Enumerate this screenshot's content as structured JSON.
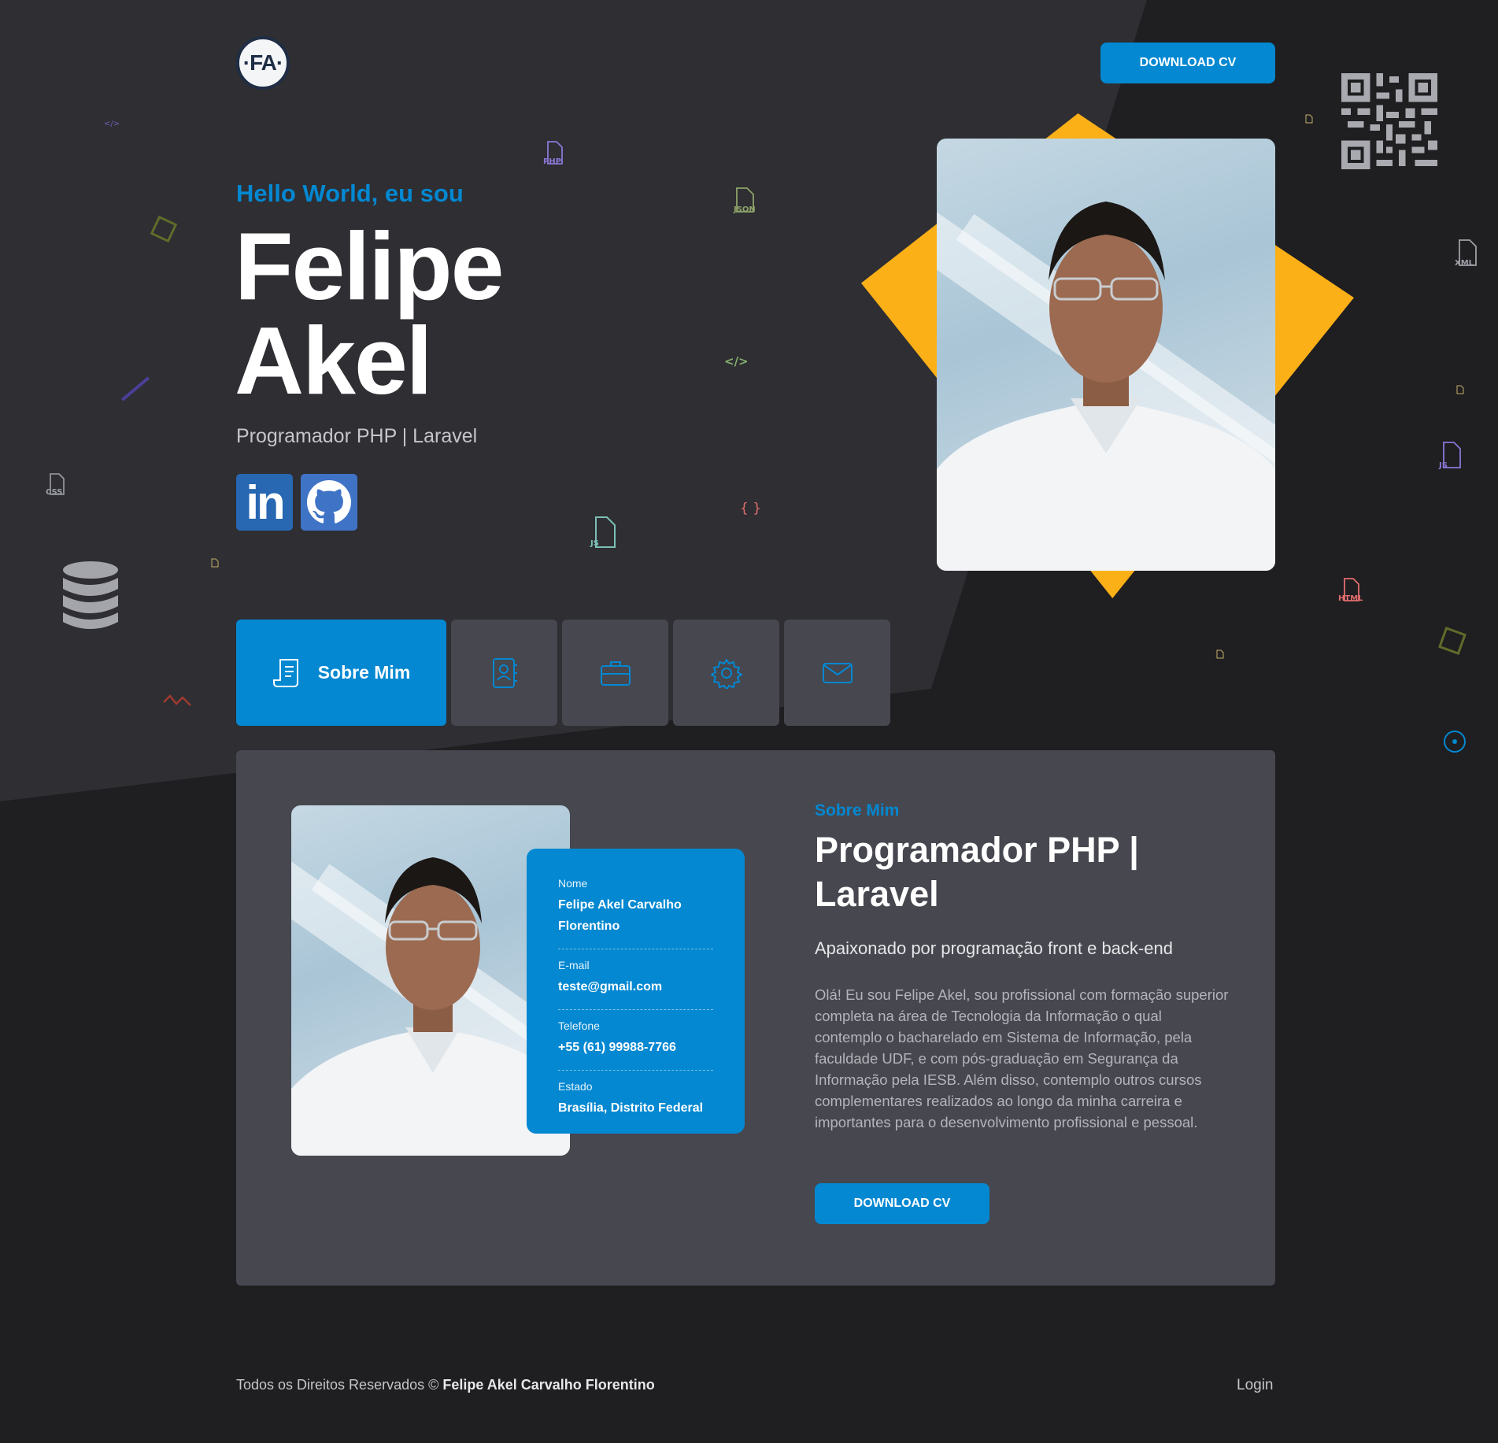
{
  "header": {
    "logo_text": "·FA·",
    "download_cv_label": "DOWNLOAD CV"
  },
  "hero": {
    "greeting": "Hello World, eu sou",
    "first_name": "Felipe",
    "last_name": "Akel",
    "role": "Programador PHP | Laravel",
    "social": [
      {
        "name": "linkedin",
        "text": "in"
      },
      {
        "name": "github"
      }
    ]
  },
  "tabs": [
    {
      "label": "Sobre Mim",
      "icon": "document-icon",
      "active": true
    },
    {
      "label": "",
      "icon": "contact-book-icon"
    },
    {
      "label": "",
      "icon": "briefcase-icon"
    },
    {
      "label": "",
      "icon": "gear-icon"
    },
    {
      "label": "",
      "icon": "envelope-icon"
    }
  ],
  "about": {
    "kicker": "Sobre Mim",
    "title": "Programador PHP | Laravel",
    "subtitle": "Apaixonado por programação front e back-end",
    "text": "Olá! Eu sou Felipe Akel, sou profissional com formação superior completa na área de Tecnologia da Informação o qual contemplo o bacharelado em Sistema de Informação, pela faculdade UDF, e com pós-graduação em Segurança da Informação pela IESB. Além disso, contemplo outros cursos complementares realizados ao longo da minha carreira e importantes para o desenvolvimento profissional e pessoal.",
    "download_cv_label": "DOWNLOAD CV",
    "info": [
      {
        "label": "Nome",
        "value": "Felipe Akel Carvalho Florentino"
      },
      {
        "label": "E-mail",
        "value": "teste@gmail.com"
      },
      {
        "label": "Telefone",
        "value": "+55 (61) 99988-7766"
      },
      {
        "label": "Estado",
        "value": "Brasília, Distrito Federal"
      }
    ]
  },
  "footer": {
    "rights_text": "Todos os Direitos Reservados ©",
    "owner": "Felipe Akel Carvalho Florentino",
    "login_label": "Login"
  },
  "decorations": {
    "file_labels": [
      "PHP",
      "JSON",
      "CSS",
      "JS",
      "XML",
      "JS",
      "HTML"
    ],
    "code_symbols": [
      "</>",
      "{ }",
      "</>"
    ]
  },
  "colors": {
    "accent": "#0388d1",
    "highlight": "#fcb017",
    "background_dark": "#1f1e21",
    "background_top": "#2e2e33",
    "panel": "#46474f"
  }
}
